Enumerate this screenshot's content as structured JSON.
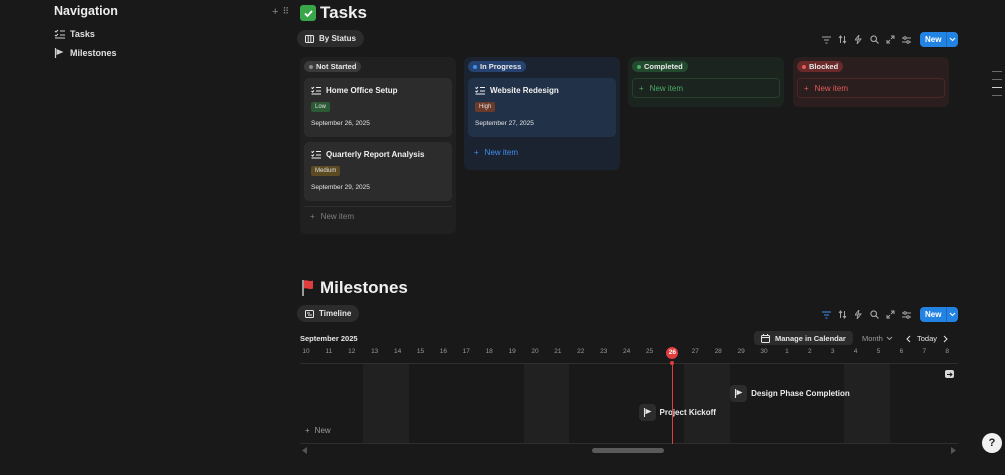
{
  "nav": {
    "title": "Navigation",
    "items": [
      {
        "label": "Tasks",
        "icon": "checklist-icon"
      },
      {
        "label": "Milestones",
        "icon": "flag-icon"
      }
    ]
  },
  "tasks": {
    "title": "Tasks",
    "view_label": "By Status",
    "new_label": "New",
    "columns": [
      {
        "status": "Not Started",
        "color": "#8c8c8c",
        "bg": "#202020",
        "pill_bg": "#3a3a3a",
        "new_item": "New item",
        "cards": [
          {
            "title": "Home Office Setup",
            "tag": "Low",
            "tag_color": "#2b5a35",
            "date": "September 26, 2025"
          },
          {
            "title": "Quarterly Report Analysis",
            "tag": "Medium",
            "tag_color": "#5c4a22",
            "date": "September 29, 2025"
          }
        ]
      },
      {
        "status": "In Progress",
        "color": "#3d8ff5",
        "bg": "#1b2330",
        "pill_bg": "#254271",
        "new_item": "New item",
        "cards": [
          {
            "title": "Website Redesign",
            "tag": "High",
            "tag_color": "#6b3a2a",
            "date": "September 27, 2025"
          }
        ]
      },
      {
        "status": "Completed",
        "color": "#4dab6a",
        "bg": "#1b241e",
        "pill_bg": "#234a2e",
        "new_item": "New item",
        "cards": []
      },
      {
        "status": "Blocked",
        "color": "#e35b58",
        "bg": "#2a1e1e",
        "pill_bg": "#6a2a2a",
        "new_item": "New item",
        "cards": []
      }
    ]
  },
  "milestones": {
    "title": "Milestones",
    "view_label": "Timeline",
    "new_label": "New",
    "month_label": "September 2025",
    "manage_label": "Manage in Calendar",
    "scale_label": "Month",
    "today_label": "Today",
    "days": [
      "10",
      "11",
      "12",
      "13",
      "14",
      "15",
      "16",
      "17",
      "18",
      "19",
      "20",
      "21",
      "22",
      "23",
      "24",
      "25",
      "26",
      "27",
      "28",
      "29",
      "30",
      "1",
      "2",
      "3",
      "4",
      "5",
      "6",
      "7",
      "8"
    ],
    "today_day": "26",
    "items": [
      {
        "name": "Project Kickoff",
        "day": "25"
      },
      {
        "name": "Design Phase Completion",
        "day": "29"
      }
    ],
    "row_new_label": "New"
  }
}
